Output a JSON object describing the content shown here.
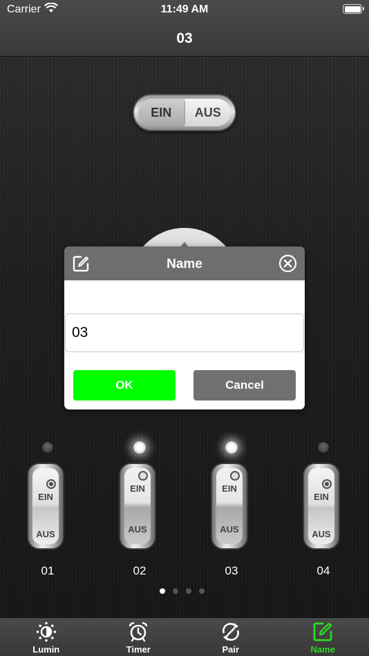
{
  "status_bar": {
    "carrier": "Carrier",
    "time": "11:49 AM"
  },
  "nav": {
    "title": "03"
  },
  "master_switch": {
    "on_label": "EIN",
    "off_label": "AUS"
  },
  "dialog": {
    "title": "Name",
    "input_value": "03",
    "ok_label": "OK",
    "cancel_label": "Cancel"
  },
  "channels": [
    {
      "label": "01",
      "on_label": "EIN",
      "off_label": "AUS",
      "led": "off",
      "position": "up"
    },
    {
      "label": "02",
      "on_label": "EIN",
      "off_label": "AUS",
      "led": "on",
      "position": "down"
    },
    {
      "label": "03",
      "on_label": "EIN",
      "off_label": "AUS",
      "led": "on",
      "position": "down"
    },
    {
      "label": "04",
      "on_label": "EIN",
      "off_label": "AUS",
      "led": "off",
      "position": "up"
    }
  ],
  "pager": {
    "pages": 4,
    "current": 1
  },
  "tabs": [
    {
      "label": "Lumin",
      "icon": "brightness-icon"
    },
    {
      "label": "Timer",
      "icon": "alarm-clock-icon"
    },
    {
      "label": "Pair",
      "icon": "sync-icon"
    },
    {
      "label": "Name",
      "icon": "edit-icon",
      "active": true
    }
  ],
  "colors": {
    "ok": "#00ff00",
    "cancel": "#707070",
    "active_tab": "#2bdc22"
  }
}
